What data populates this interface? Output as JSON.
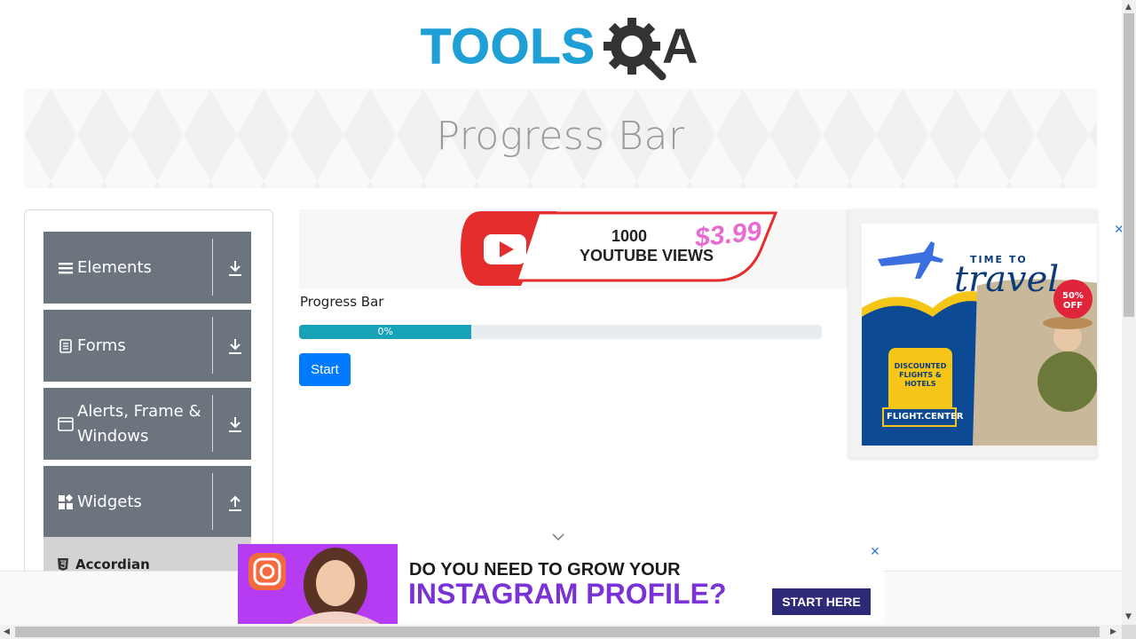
{
  "logo": {
    "text": "TOOLS",
    "suffix": "A"
  },
  "banner": {
    "title": "Progress Bar"
  },
  "sidebar": {
    "groups": [
      {
        "label": "Elements",
        "icon": "list-icon",
        "arrow": "download-arrow-icon"
      },
      {
        "label": "Forms",
        "icon": "document-icon",
        "arrow": "download-arrow-icon"
      },
      {
        "label": "Alerts, Frame & Windows",
        "icon": "window-icon",
        "arrow": "download-arrow-icon"
      },
      {
        "label": "Widgets",
        "icon": "widgets-icon",
        "arrow": "upload-arrow-icon"
      }
    ],
    "sub_items": [
      {
        "label": "Accordian",
        "icon": "html5-icon"
      }
    ]
  },
  "main": {
    "ad_top": {
      "line1": "1000",
      "line2": "YOUTUBE VIEWS",
      "price": "$3.99"
    },
    "title": "Progress Bar",
    "progress": {
      "label": "0%",
      "value_fraction": 0.33
    },
    "start_label": "Start"
  },
  "ad_right": {
    "headline1": "TIME TO",
    "headline2": "travel",
    "badge": "50% OFF",
    "card_text": "DISCOUNTED FLIGHTS & HOTELS",
    "brand": "FLIGHT.CENTER"
  },
  "ad_bottom": {
    "line1": "DO YOU NEED TO GROW YOUR",
    "line2": "INSTAGRAM PROFILE?",
    "cta": "START HERE"
  },
  "colors": {
    "sidebar_group": "#6c757d",
    "progress_fill": "#17a2b8",
    "primary_button": "#007bff",
    "logo_blue": "#1e9fd6"
  }
}
